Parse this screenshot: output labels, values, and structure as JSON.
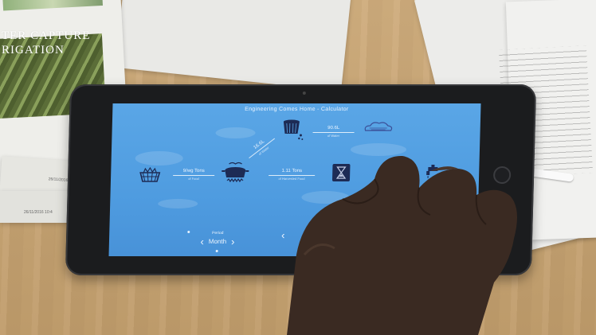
{
  "scene": {
    "poster_title": "TER CAPTURE\nRIGATION",
    "paper_date_1": "26/11/2016 10:4",
    "paper_date_2": "26/11/2016 10:4"
  },
  "app": {
    "title": "Engineering Comes Home - Calculator",
    "nodes": [
      {
        "id": "harvest",
        "icon": "harvest-basket-icon"
      },
      {
        "id": "cooking",
        "icon": "cooking-pot-icon"
      },
      {
        "id": "water",
        "icon": "water-bucket-icon"
      },
      {
        "id": "time",
        "icon": "hourglass-icon"
      },
      {
        "id": "tap",
        "icon": "tap-water-icon"
      },
      {
        "id": "cloud",
        "icon": "rain-cloud-icon"
      }
    ],
    "links": {
      "harvest_to_cooking": {
        "value": "9/wg Tons",
        "unit": "of Food"
      },
      "cooking_to_water": {
        "value": "16.6L",
        "unit": "of Water"
      },
      "water_to_cloud": {
        "value": "90.6L",
        "unit": "of Water"
      },
      "cooking_to_time": {
        "value": "1.11 Tons",
        "unit": "of Harvested Food"
      }
    },
    "period": {
      "label": "Period",
      "value": "Month"
    }
  },
  "colors": {
    "screen": "#4f9ce0",
    "desk": "#c9a777",
    "bezel": "#1b1c1e"
  }
}
